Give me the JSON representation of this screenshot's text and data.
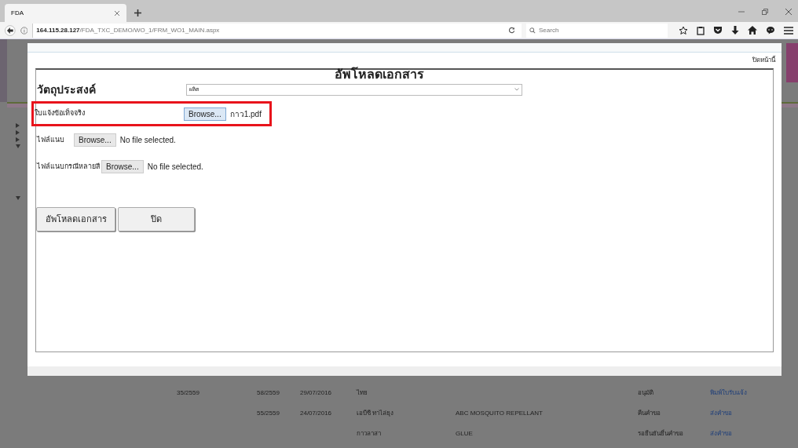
{
  "browser": {
    "tabs": [
      {
        "title": "FDA",
        "selected": true
      }
    ],
    "url_host": "164.115.28.127",
    "url_path": "/FDA_TXC_DEMO/WO_1/FRM_WO1_MAIN.aspx",
    "search": {
      "placeholder": "Search"
    }
  },
  "background_table": {
    "rows": [
      {
        "column_1": "35/2559",
        "column_2": "58/2559",
        "column_3": "29/07/2016",
        "column_4": "ไทย",
        "column_6": "อนุมัติ",
        "column_7": "พิมพ์ใบรับแจ้ง"
      },
      {
        "column_2": "55/2559",
        "column_3": "24/07/2016",
        "column_4": "เอบีซี ทาไล่ยุง",
        "column_5": "ABC MOSQUITO REPELLANT",
        "column_6": "คืนคำขอ",
        "column_7": "ส่งคำขอ"
      },
      {
        "column_4": "กาวลาสา",
        "column_5": "GLUE",
        "column_6": "รอยืนยันยื่นคำขอ",
        "column_7": "ส่งคำขอ"
      }
    ]
  },
  "dialog": {
    "close_link": "ปิดหน้านี้",
    "title": "อัพโหลดเอกสาร",
    "fields": [
      {
        "kind": "select",
        "label": "วัตถุประสงค์",
        "value": "ผลิต",
        "highlighted": false
      },
      {
        "kind": "file",
        "label": "ใบแจ้งข้อเท็จจริง",
        "button": "Browse...",
        "file": "กาว1.pdf",
        "highlighted": true
      },
      {
        "kind": "file",
        "label": "ไฟล์แนบ",
        "button": "Browse...",
        "file": "No file selected.",
        "highlighted": false
      },
      {
        "kind": "file",
        "label": "ไฟล์แนบกรณีหลายสี",
        "button": "Browse...",
        "file": "No file selected.",
        "highlighted": false
      }
    ],
    "buttons": [
      "อัพโหลดเอกสาร",
      "ปิด"
    ]
  }
}
